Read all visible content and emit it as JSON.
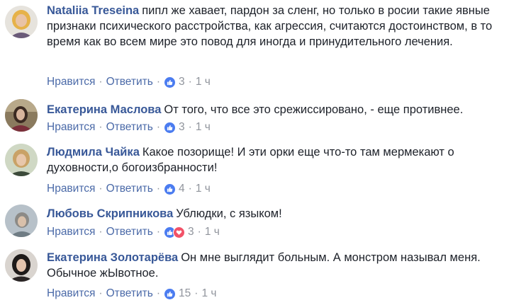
{
  "actions": {
    "like": "Нравится",
    "reply": "Ответить",
    "dot": "·"
  },
  "colors": {
    "author": "#385898",
    "like": "#4b7cf0",
    "love": "#f25268"
  },
  "comments": [
    {
      "author": "Nataliia Treseina",
      "text": "пипл же хавает, пардон за сленг, но только в росии такие явные признаки психического расстройства, как агрессия, считаются достоинством, в то время как во всем мире это повод для иногда и принудительного лечения.",
      "reactions": [
        "like-icon"
      ],
      "reaction_count": "3",
      "time": "1 ч"
    },
    {
      "author": "Екатерина Маслова",
      "text": "От того, что все это срежиссировано, - еще противнее.",
      "reactions": [
        "like-icon"
      ],
      "reaction_count": "3",
      "time": "1 ч"
    },
    {
      "author": "Людмила Чайка",
      "text": "Какое позорище! И эти орки еще что-то там мермекают о духовности,о богоизбранности!",
      "reactions": [
        "like-icon"
      ],
      "reaction_count": "4",
      "time": "1 ч"
    },
    {
      "author": "Любовь Скрипникова",
      "text": "Ублюдки, с языком!",
      "reactions": [
        "like-icon",
        "love-icon"
      ],
      "reaction_count": "3",
      "time": "1 ч"
    },
    {
      "author": "Екатерина Золотарёва",
      "text": "Он мне выглядит больным. А монстром называл меня. Обычное жЫвотное.",
      "reactions": [
        "like-icon"
      ],
      "reaction_count": "15",
      "time": "1 ч"
    }
  ]
}
